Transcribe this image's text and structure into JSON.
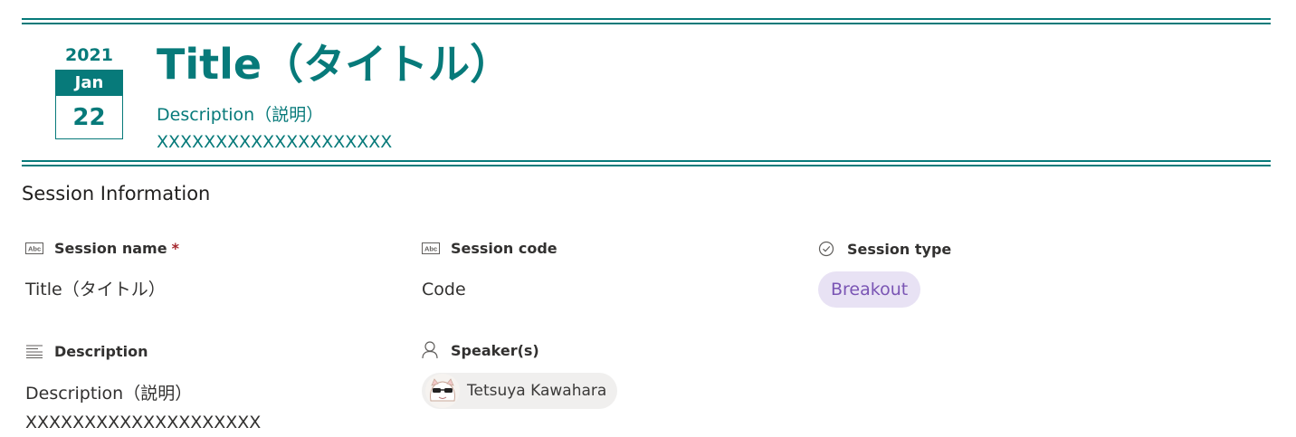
{
  "header": {
    "year": "2021",
    "month": "Jan",
    "day": "22",
    "title": "Title（タイトル）",
    "description_line1": "Description（説明）",
    "description_line2": "XXXXXXXXXXXXXXXXXXXX"
  },
  "section": {
    "title": "Session Information"
  },
  "fields": {
    "session_name": {
      "label": "Session name",
      "required_mark": "*",
      "value": "Title（タイトル）",
      "icon": "text-field-icon"
    },
    "session_code": {
      "label": "Session code",
      "value": "Code",
      "icon": "text-field-icon"
    },
    "session_type": {
      "label": "Session type",
      "value": "Breakout",
      "icon": "check-circle-icon"
    },
    "description": {
      "label": "Description",
      "value_line1": "Description（説明）",
      "value_line2": "XXXXXXXXXXXXXXXXXXXX",
      "icon": "multiline-text-icon"
    },
    "speakers": {
      "label": "Speaker(s)",
      "person_name": "Tetsuya Kawahara",
      "icon": "person-icon"
    }
  },
  "colors": {
    "accent": "#077a7a",
    "pill_bg": "#e8e2f4",
    "pill_text": "#7a55b4",
    "required": "#a4262c"
  }
}
